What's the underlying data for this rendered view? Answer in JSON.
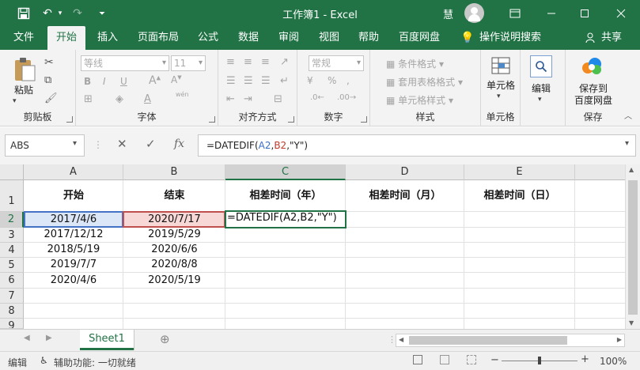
{
  "titlebar": {
    "title": "工作簿1 - Excel",
    "user": "慧",
    "undo_caret": "▾",
    "customize": "⏷"
  },
  "tabs": [
    "文件",
    "开始",
    "插入",
    "页面布局",
    "公式",
    "数据",
    "审阅",
    "视图",
    "帮助",
    "百度网盘",
    "操作说明搜索",
    "共享"
  ],
  "ribbon": {
    "clipboard": {
      "paste": "粘贴",
      "label": "剪贴板"
    },
    "font": {
      "name": "等线",
      "size": "11",
      "bold": "B",
      "italic": "I",
      "underline": "U",
      "label": "字体",
      "wen": "wén"
    },
    "alignment": {
      "label": "对齐方式"
    },
    "number": {
      "format": "常规",
      "percent": "%",
      "comma": ",",
      "label": "数字"
    },
    "styles": {
      "conditional": "条件格式",
      "table": "套用表格格式",
      "cell": "单元格样式",
      "label": "样式"
    },
    "cells": {
      "label": "单元格"
    },
    "editing": {
      "label": "编辑"
    },
    "save": {
      "line1": "保存到",
      "line2": "百度网盘",
      "label": "保存"
    }
  },
  "formula_bar": {
    "name_box": "ABS",
    "fx": "fx",
    "formula_prefix": "=DATEDIF(",
    "formula_ref_a": "A2",
    "formula_comma1": ",",
    "formula_ref_b": "B2",
    "formula_suffix": ",\"Y\")"
  },
  "grid": {
    "columns": [
      "A",
      "B",
      "C",
      "D",
      "E"
    ],
    "rows": [
      "1",
      "2",
      "3",
      "4",
      "5",
      "6",
      "7",
      "8",
      "9"
    ],
    "headers": [
      "开始",
      "结束",
      "相差时间（年）",
      "相差时间（月）",
      "相差时间（日）"
    ],
    "data": [
      [
        "2017/4/6",
        "2020/7/17",
        "=DATEDIF(A2,B2,\"Y\")"
      ],
      [
        "2017/12/12",
        "2019/5/29",
        ""
      ],
      [
        "2018/5/19",
        "2020/6/6",
        ""
      ],
      [
        "2019/7/7",
        "2020/8/8",
        ""
      ],
      [
        "2020/4/6",
        "2020/5/19",
        ""
      ]
    ]
  },
  "sheets": {
    "active": "Sheet1",
    "add": "⊕"
  },
  "statusbar": {
    "mode": "编辑",
    "accessibility": "辅助功能: 一切就绪",
    "zoom": "100%"
  },
  "colors": {
    "accent": "#217346",
    "ref_a": "#4472c4",
    "ref_b": "#c0504d"
  }
}
